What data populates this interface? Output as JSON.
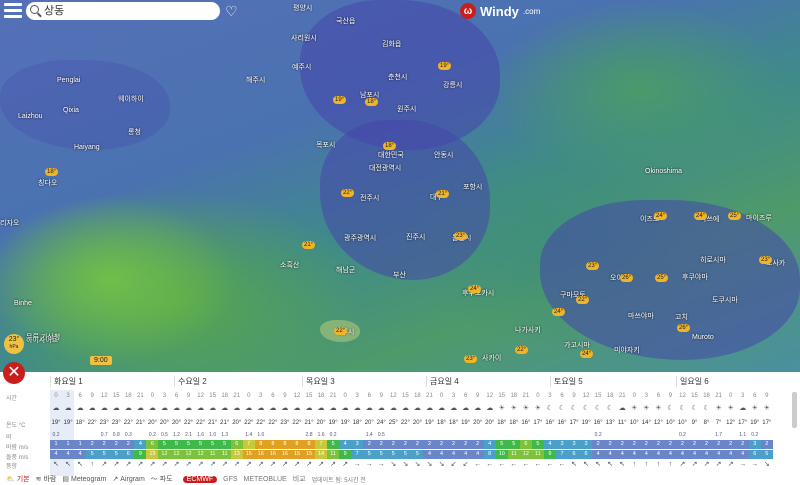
{
  "app": {
    "logo_text": "Windy",
    "logo_domain": ".com"
  },
  "search": {
    "value": "상동"
  },
  "map": {
    "towns": [
      "평양시",
      "국산읍",
      "사리원시",
      "김화읍",
      "춘천시",
      "예주시",
      "해주시",
      "남포시",
      "강릉시",
      "원주시",
      "대전광역시",
      "대한민국",
      "안동시",
      "전주시",
      "포항시",
      "대구",
      "광주광역시",
      "진주시",
      "울산시",
      "목포시",
      "해남군",
      "부산",
      "소흑산",
      "후쿠오카시",
      "제주시",
      "하이사이트",
      "Penglai",
      "Qixia",
      "Laizhou",
      "Haiyang",
      "웨이하이",
      "롱청",
      "칭다오",
      "리자오",
      "Binhe",
      "Okinoshima",
      "히로시마",
      "마이즈루",
      "오사카",
      "Muroto",
      "도쿠시마",
      "후쿠야마",
      "미야자키",
      "가고시마",
      "구마모토",
      "나가사키",
      "마쓰야마",
      "고치",
      "오이타",
      "이즈모",
      "마쓰에",
      "사카이"
    ],
    "temps": [
      "19°",
      "18°",
      "18°",
      "19°",
      "22°",
      "21°",
      "23°",
      "24°",
      "22°",
      "21°",
      "24°",
      "25°",
      "23°",
      "22°",
      "26°",
      "24°",
      "23°",
      "25°",
      "24°",
      "26°",
      "22°",
      "23°",
      "18°",
      "24°"
    ],
    "station_temp": "23°",
    "station_unit": "hPa",
    "station_name": "무루 기상청",
    "time_marker": "9:00"
  },
  "forecast": {
    "days": [
      "화요일 1",
      "수요일 2",
      "목요일 3",
      "금요일 4",
      "토요일 5",
      "일요일 6"
    ],
    "labels": [
      "시간",
      "",
      "온도 °C",
      "비",
      "바람 m/s",
      "돌풍 m/s",
      "풍향"
    ],
    "units": {
      "temp": "°C",
      "rain": "mm",
      "wind": "m/s",
      "gust": "m/s"
    },
    "hours": [
      "0",
      "3",
      "6",
      "9",
      "12",
      "15",
      "18",
      "21",
      "0",
      "3",
      "6",
      "9",
      "12",
      "15",
      "18",
      "21",
      "0",
      "3",
      "6",
      "9",
      "12",
      "15",
      "18",
      "21",
      "0",
      "3",
      "6",
      "9",
      "12",
      "15",
      "18",
      "21",
      "0",
      "3",
      "6",
      "9",
      "12",
      "15",
      "18",
      "21",
      "0",
      "3",
      "6",
      "9",
      "12",
      "15",
      "18",
      "21",
      "0",
      "3",
      "6",
      "9",
      "12",
      "15",
      "18",
      "21",
      "0",
      "3",
      "6",
      "9"
    ],
    "icons": [
      "☁",
      "☁",
      "☁",
      "☁",
      "☁",
      "☁",
      "☁",
      "☁",
      "☁",
      "☁",
      "☁",
      "☁",
      "☁",
      "☁",
      "☁",
      "☁",
      "☁",
      "☁",
      "☁",
      "☁",
      "☁",
      "☁",
      "☁",
      "☁",
      "☁",
      "☁",
      "☁",
      "☁",
      "☁",
      "☁",
      "☁",
      "☁",
      "☁",
      "☁",
      "☁",
      "☁",
      "☁",
      "☀",
      "☀",
      "☀",
      "☀",
      "☾",
      "☾",
      "☾",
      "☾",
      "☾",
      "☾",
      "☁",
      "☀",
      "☀",
      "☀",
      "☾",
      "☾",
      "☾",
      "☾",
      "☀",
      "☀",
      "☁",
      "☀",
      "☀"
    ],
    "temps": [
      "19°",
      "19°",
      "18°",
      "22°",
      "23°",
      "23°",
      "22°",
      "21°",
      "20°",
      "20°",
      "20°",
      "22°",
      "22°",
      "21°",
      "21°",
      "20°",
      "22°",
      "22°",
      "22°",
      "23°",
      "22°",
      "21°",
      "20°",
      "19°",
      "19°",
      "18°",
      "20°",
      "24°",
      "25°",
      "22°",
      "20°",
      "19°",
      "18°",
      "18°",
      "19°",
      "20°",
      "20°",
      "18°",
      "18°",
      "16°",
      "17°",
      "16°",
      "16°",
      "17°",
      "19°",
      "16°",
      "13°",
      "11°",
      "10°",
      "14°",
      "12°",
      "10°",
      "10°",
      "9°",
      "8°",
      "7°",
      "12°",
      "17°",
      "19°",
      "17°"
    ],
    "rain": [
      "0.2",
      "",
      "",
      "",
      "0.7",
      "0.8",
      "0.3",
      "",
      "0.2",
      "0.5",
      "1.2",
      "2.1",
      "1.6",
      "1.0",
      "1.3",
      "",
      "1.4",
      "1.0",
      "",
      "",
      "",
      "2.8",
      "1.6",
      "0.2",
      "",
      "",
      "1.4",
      "0.5",
      "",
      "",
      "",
      "",
      "",
      "",
      "",
      "",
      "",
      "",
      "",
      "",
      "",
      "",
      "",
      "",
      "",
      "0.2",
      "",
      "",
      "",
      "",
      "",
      "",
      "0.2",
      "",
      "",
      "1.7",
      "",
      "1.1",
      "0.2",
      ""
    ],
    "wind": [
      "1",
      "1",
      "1",
      "2",
      "2",
      "2",
      "2",
      "4",
      "6",
      "5",
      "5",
      "5",
      "5",
      "5",
      "5",
      "6",
      "7",
      "8",
      "8",
      "8",
      "8",
      "8",
      "7",
      "5",
      "4",
      "3",
      "2",
      "2",
      "2",
      "2",
      "2",
      "2",
      "2",
      "2",
      "2",
      "2",
      "4",
      "5",
      "5",
      "6",
      "5",
      "4",
      "3",
      "3",
      "3",
      "2",
      "2",
      "2",
      "2",
      "2",
      "2",
      "2",
      "2",
      "2",
      "2",
      "2",
      "2",
      "2",
      "3",
      "2"
    ],
    "gust": [
      "4",
      "4",
      "4",
      "5",
      "5",
      "5",
      "6",
      "9",
      "13",
      "12",
      "12",
      "12",
      "12",
      "11",
      "11",
      "13",
      "15",
      "16",
      "16",
      "16",
      "15",
      "15",
      "14",
      "11",
      "9",
      "7",
      "5",
      "5",
      "5",
      "5",
      "5",
      "4",
      "4",
      "4",
      "4",
      "4",
      "8",
      "10",
      "11",
      "12",
      "11",
      "9",
      "7",
      "6",
      "6",
      "4",
      "4",
      "4",
      "4",
      "4",
      "4",
      "4",
      "4",
      "4",
      "4",
      "4",
      "4",
      "4",
      "6",
      "5"
    ],
    "directions": [
      "↖",
      "↖",
      "↖",
      "↑",
      "↗",
      "↗",
      "↗",
      "↗",
      "↗",
      "↗",
      "↗",
      "↗",
      "↗",
      "↗",
      "↗",
      "↗",
      "↗",
      "↗",
      "↗",
      "↗",
      "↗",
      "↗",
      "↗",
      "↗",
      "↗",
      "→",
      "→",
      "→",
      "↘",
      "↘",
      "↘",
      "↘",
      "↘",
      "↙",
      "↙",
      "←",
      "←",
      "←",
      "←",
      "←",
      "←",
      "←",
      "←",
      "↖",
      "↖",
      "↖",
      "↖",
      "↖",
      "↑",
      "↑",
      "↑",
      "↑",
      "↗",
      "↗",
      "↗",
      "↗",
      "↗",
      "→",
      "→",
      "↘"
    ]
  },
  "bottom": {
    "tabs": [
      "기본",
      "바람",
      "Meteogram",
      "Airgram",
      "파도"
    ],
    "models": [
      "ECMWF",
      "GFS",
      "METEOBLUE",
      "비교"
    ],
    "updated": "업데이트 됨: 5시간 전"
  },
  "colors": {
    "accent": "#c81e1e",
    "windy_low": "#6a86c8",
    "windy_mid": "#3fb94a",
    "windy_high": "#e0a020"
  }
}
